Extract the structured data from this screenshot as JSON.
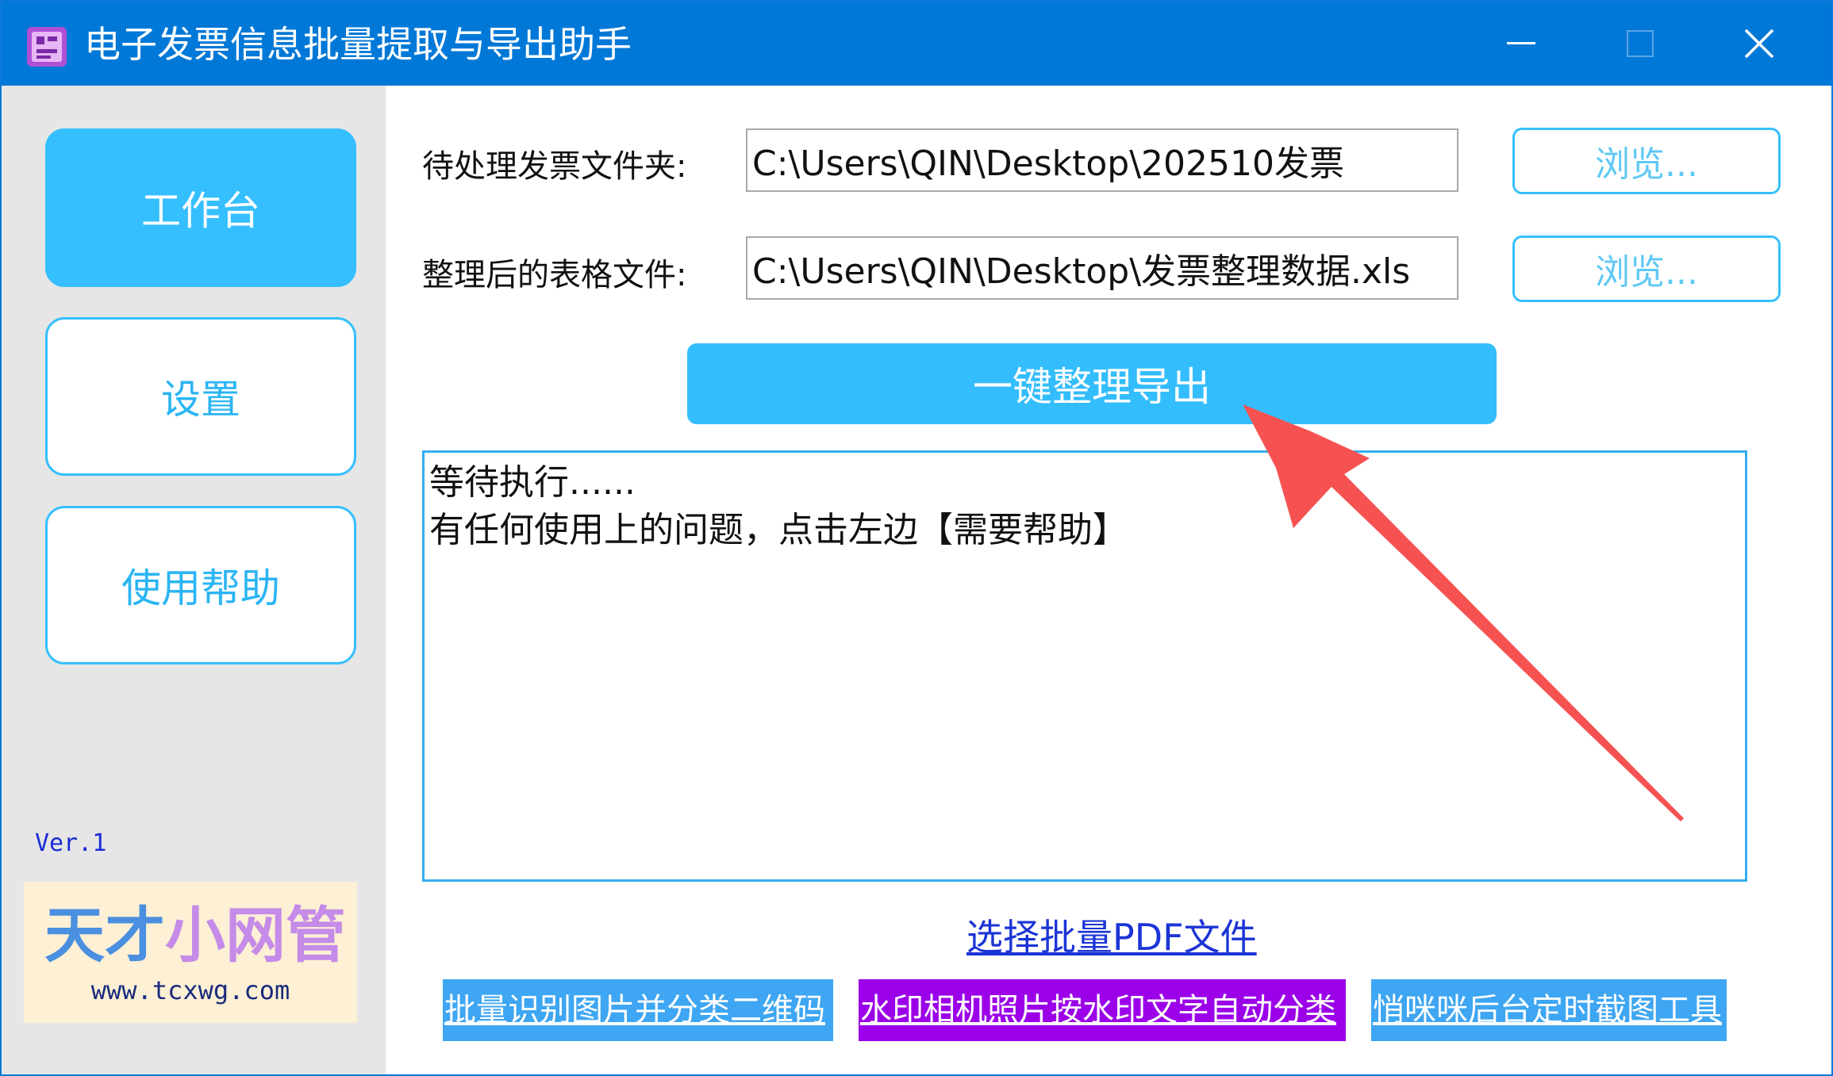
{
  "window": {
    "title": "电子发票信息批量提取与导出助手",
    "minimize_icon": "minimize-icon",
    "maximize_icon": "maximize-icon",
    "close_icon": "close-icon"
  },
  "sidebar": {
    "items": [
      {
        "label": "工作台",
        "active": true
      },
      {
        "label": "设置",
        "active": false
      },
      {
        "label": "使用帮助",
        "active": false
      }
    ],
    "version": "Ver.1",
    "logo": {
      "main_part1": "天才",
      "main_part2": "小网管",
      "url": "www.tcxwg.com"
    }
  },
  "main": {
    "source_folder": {
      "label": "待处理发票文件夹:",
      "value": "C:\\Users\\QIN\\Desktop\\202510发票",
      "browse_label": "浏览..."
    },
    "output_file": {
      "label": "整理后的表格文件:",
      "value": "C:\\Users\\QIN\\Desktop\\发票整理数据.xls",
      "browse_label": "浏览..."
    },
    "export_button": "一键整理导出",
    "log": [
      "等待执行......",
      "有任何使用上的问题，点击左边【需要帮助】"
    ],
    "pdf_link": "选择批量PDF文件",
    "tool_links": [
      "批量识别图片并分类二维码",
      "水印相机照片按水印文字自动分类",
      "悄咪咪后台定时截图工具"
    ]
  },
  "colors": {
    "titlebar": "#0078d7",
    "accent": "#36bfff",
    "sidebar_bg": "#e6e6e6",
    "link": "#1b34d6",
    "purple": "#9b00e8",
    "annotation_arrow": "#f65252"
  }
}
